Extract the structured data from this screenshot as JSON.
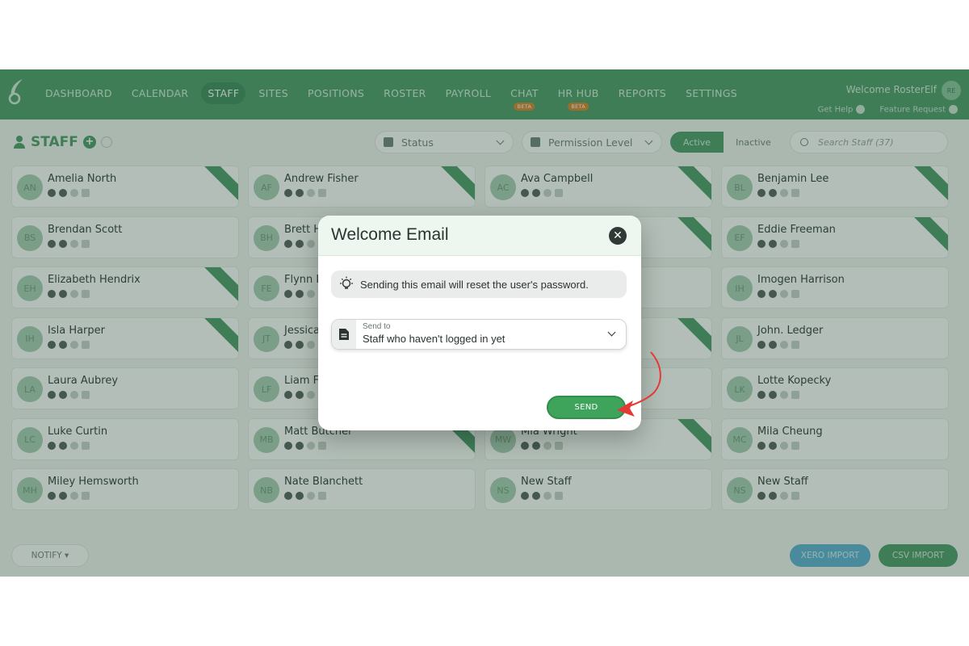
{
  "nav": {
    "items": [
      {
        "label": "DASHBOARD",
        "active": false
      },
      {
        "label": "CALENDAR",
        "active": false
      },
      {
        "label": "STAFF",
        "active": true
      },
      {
        "label": "SITES",
        "active": false
      },
      {
        "label": "POSITIONS",
        "active": false
      },
      {
        "label": "ROSTER",
        "active": false
      },
      {
        "label": "PAYROLL",
        "active": false
      },
      {
        "label": "CHAT",
        "active": false,
        "badge": "BETA"
      },
      {
        "label": "HR HUB",
        "active": false,
        "badge": "BETA"
      },
      {
        "label": "REPORTS",
        "active": false
      },
      {
        "label": "SETTINGS",
        "active": false
      }
    ],
    "welcome": "Welcome RosterElf",
    "avatar_initials": "RE",
    "get_help": "Get Help",
    "feature_request": "Feature Request"
  },
  "toolbar": {
    "title": "STAFF",
    "status_placeholder": "Status",
    "permission_placeholder": "Permission Level",
    "active_label": "Active",
    "inactive_label": "Inactive",
    "search_placeholder": "Search Staff (37)"
  },
  "staff": [
    {
      "initials": "AN",
      "name": "Amelia North",
      "ribbon": true
    },
    {
      "initials": "AF",
      "name": "Andrew Fisher",
      "ribbon": true
    },
    {
      "initials": "AC",
      "name": "Ava Campbell",
      "ribbon": true
    },
    {
      "initials": "BL",
      "name": "Benjamin Lee",
      "ribbon": true
    },
    {
      "initials": "BS",
      "name": "Brendan Scott",
      "ribbon": false
    },
    {
      "initials": "BH",
      "name": "Brett H",
      "ribbon": false
    },
    {
      "initials": "",
      "name": "",
      "ribbon": true
    },
    {
      "initials": "EF",
      "name": "Eddie Freeman",
      "ribbon": true
    },
    {
      "initials": "EH",
      "name": "Elizabeth Hendrix",
      "ribbon": true
    },
    {
      "initials": "FE",
      "name": "Flynn E",
      "ribbon": false
    },
    {
      "initials": "",
      "name": "",
      "ribbon": false
    },
    {
      "initials": "IH",
      "name": "Imogen Harrison",
      "ribbon": false
    },
    {
      "initials": "IH",
      "name": "Isla Harper",
      "ribbon": true
    },
    {
      "initials": "JT",
      "name": "Jessica",
      "ribbon": false
    },
    {
      "initials": "",
      "name": "",
      "ribbon": true
    },
    {
      "initials": "JL",
      "name": "John. Ledger",
      "ribbon": false
    },
    {
      "initials": "LA",
      "name": "Laura Aubrey",
      "ribbon": false
    },
    {
      "initials": "LF",
      "name": "Liam F",
      "ribbon": false
    },
    {
      "initials": "",
      "name": "",
      "ribbon": false
    },
    {
      "initials": "LK",
      "name": "Lotte Kopecky",
      "ribbon": false
    },
    {
      "initials": "LC",
      "name": "Luke Curtin",
      "ribbon": false
    },
    {
      "initials": "MB",
      "name": "Matt Butcher",
      "ribbon": true
    },
    {
      "initials": "MW",
      "name": "Mia Wright",
      "ribbon": true
    },
    {
      "initials": "MC",
      "name": "Mila Cheung",
      "ribbon": false
    },
    {
      "initials": "MH",
      "name": "Miley Hemsworth",
      "ribbon": false
    },
    {
      "initials": "NB",
      "name": "Nate Blanchett",
      "ribbon": false
    },
    {
      "initials": "NS",
      "name": "New Staff",
      "ribbon": false
    },
    {
      "initials": "NS",
      "name": "New Staff",
      "ribbon": false
    }
  ],
  "footer": {
    "notify": "NOTIFY ▾",
    "xero_import": "XERO IMPORT",
    "csv_import": "CSV IMPORT"
  },
  "modal": {
    "title": "Welcome Email",
    "notice": "Sending this email will reset the user's password.",
    "send_to_label": "Send to",
    "send_to_value": "Staff who haven't logged in yet",
    "send_button": "SEND"
  },
  "colors": {
    "brand_green": "#4c9a6a",
    "send_green": "#3ea45c",
    "annotation_red": "#e53935"
  }
}
